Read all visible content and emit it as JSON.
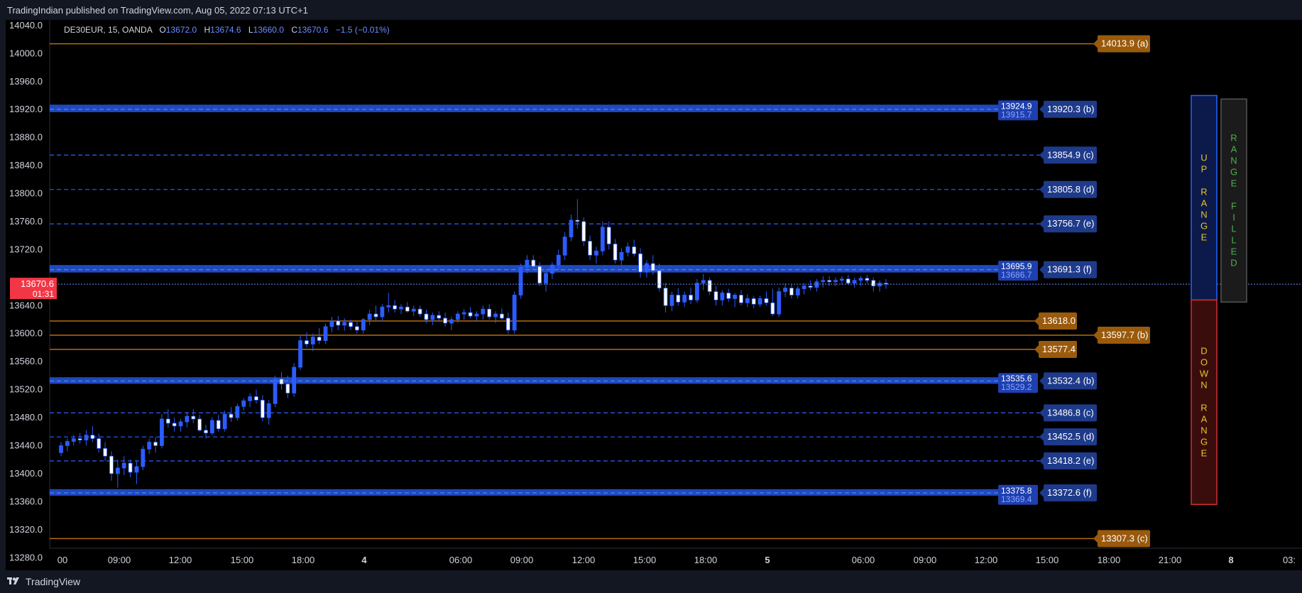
{
  "header": {
    "published": "TradingIndian published on TradingView.com, Aug 05, 2022 07:13 UTC+1"
  },
  "legend": {
    "symbol": "DE30EUR, 15, OANDA",
    "o_label": "O",
    "o": "13672.0",
    "h_label": "H",
    "h": "13674.6",
    "l_label": "L",
    "l": "13660.0",
    "c_label": "C",
    "c": "13670.6",
    "change": "−1.5 (−0.01%)"
  },
  "footer": {
    "brand": "TradingView"
  },
  "colors": {
    "background": "#000000",
    "blue": "#2962ff",
    "blue_label": "#1e3a8a",
    "orange": "#b86a10",
    "orange_label": "#9a5a0c",
    "candle_up": "#2b5cff",
    "candle_down": "#ffffff",
    "current_price": "#f23645"
  },
  "current_price": {
    "value": "13670.6",
    "countdown": "01:31",
    "level": 13670.6
  },
  "chart_data": {
    "type": "candlestick",
    "y_axis": {
      "ylim": [
        13262,
        14048
      ],
      "ticks": [
        14040.0,
        14000.0,
        13960.0,
        13920.0,
        13880.0,
        13840.0,
        13800.0,
        13760.0,
        13720.0,
        13640.0,
        13600.0,
        13560.0,
        13520.0,
        13480.0,
        13440.0,
        13400.0,
        13360.0,
        13320.0,
        13280.0
      ],
      "tick_labels": [
        "14040.0",
        "14000.0",
        "13960.0",
        "13920.0",
        "13880.0",
        "13840.0",
        "13800.0",
        "13760.0",
        "13720.0",
        "13640.0",
        "13600.0",
        "13560.0",
        "13520.0",
        "13480.0",
        "13440.0",
        "13400.0",
        "13360.0",
        "13320.0",
        "13280.0"
      ]
    },
    "x_axis": {
      "tick_labels": [
        "00",
        "09:00",
        "12:00",
        "15:00",
        "18:00",
        "4",
        "06:00",
        "09:00",
        "12:00",
        "15:00",
        "18:00",
        "5",
        "06:00",
        "09:00",
        "12:00",
        "15:00",
        "18:00",
        "21:00",
        "8",
        "03:"
      ],
      "bold": [
        "4",
        "5",
        "8"
      ]
    },
    "levels": [
      {
        "label": "14013.9 (a)",
        "value": 14013.9,
        "color": "orange",
        "style": "solid",
        "tag": "wide"
      },
      {
        "label": "13920.3 (b)",
        "value": 13920.3,
        "color": "blue",
        "style": "band",
        "upper": 13924.9,
        "upper_label": "13924.9",
        "lower_label": "13915.7"
      },
      {
        "label": "13854.9 (c)",
        "value": 13854.9,
        "color": "blue",
        "style": "dashed"
      },
      {
        "label": "13805.8 (d)",
        "value": 13805.8,
        "color": "blue",
        "style": "dashed"
      },
      {
        "label": "13756.7 (e)",
        "value": 13756.7,
        "color": "blue",
        "style": "dashed"
      },
      {
        "label": "13691.3 (f)",
        "value": 13691.3,
        "color": "blue",
        "style": "band",
        "upper": 13695.9,
        "upper_label": "13695.9",
        "lower_label": "13686.7"
      },
      {
        "label": "13618.0",
        "value": 13618.0,
        "color": "orange",
        "style": "solid",
        "tag": "short"
      },
      {
        "label": "13597.7 (b)",
        "value": 13597.7,
        "color": "orange",
        "style": "solid",
        "tag": "wide"
      },
      {
        "label": "13577.4",
        "value": 13577.4,
        "color": "orange",
        "style": "solid",
        "tag": "short"
      },
      {
        "label": "13532.4 (b)",
        "value": 13532.4,
        "color": "blue",
        "style": "band",
        "upper": 13535.6,
        "upper_label": "13535.6",
        "lower_label": "13529.2"
      },
      {
        "label": "13486.8 (c)",
        "value": 13486.8,
        "color": "blue",
        "style": "dashed"
      },
      {
        "label": "13452.5 (d)",
        "value": 13452.5,
        "color": "blue",
        "style": "dashed"
      },
      {
        "label": "13418.2 (e)",
        "value": 13418.2,
        "color": "blue",
        "style": "dashed"
      },
      {
        "label": "13372.6 (f)",
        "value": 13372.6,
        "color": "blue",
        "style": "band",
        "upper": 13375.8,
        "upper_label": "13375.8",
        "lower_label": "13369.4"
      },
      {
        "label": "13307.3 (c)",
        "value": 13307.3,
        "color": "orange",
        "style": "solid",
        "tag": "wide"
      }
    ],
    "range_boxes": [
      {
        "text": "UP RANGE",
        "top": 13940,
        "bottom": 13648,
        "text_color": "#e6c229",
        "border": "#2962ff",
        "fill": "#0b1a4a"
      },
      {
        "text": "DOWN RANGE",
        "top": 13648,
        "bottom": 13356,
        "text_color": "#e6c229",
        "border": "#d32f2f",
        "fill": "#3a0d0d"
      },
      {
        "text": "RANGE FILLED",
        "top": 13935,
        "bottom": 13645,
        "text_color": "#4caf50",
        "border": "#555555",
        "fill": "#1b1b1b"
      }
    ],
    "candles": [
      [
        13430,
        13445,
        13425,
        13440
      ],
      [
        13440,
        13450,
        13432,
        13446
      ],
      [
        13446,
        13455,
        13440,
        13450
      ],
      [
        13450,
        13458,
        13443,
        13448
      ],
      [
        13448,
        13462,
        13440,
        13455
      ],
      [
        13455,
        13468,
        13445,
        13450
      ],
      [
        13450,
        13457,
        13430,
        13436
      ],
      [
        13436,
        13445,
        13418,
        13425
      ],
      [
        13425,
        13432,
        13390,
        13400
      ],
      [
        13400,
        13420,
        13380,
        13408
      ],
      [
        13408,
        13425,
        13398,
        13415
      ],
      [
        13415,
        13420,
        13395,
        13402
      ],
      [
        13402,
        13418,
        13385,
        13410
      ],
      [
        13410,
        13440,
        13405,
        13435
      ],
      [
        13435,
        13450,
        13428,
        13445
      ],
      [
        13445,
        13452,
        13430,
        13440
      ],
      [
        13440,
        13485,
        13436,
        13478
      ],
      [
        13478,
        13492,
        13466,
        13472
      ],
      [
        13472,
        13480,
        13460,
        13468
      ],
      [
        13468,
        13478,
        13460,
        13474
      ],
      [
        13474,
        13488,
        13466,
        13482
      ],
      [
        13482,
        13492,
        13472,
        13478
      ],
      [
        13478,
        13484,
        13460,
        13462
      ],
      [
        13462,
        13470,
        13450,
        13458
      ],
      [
        13458,
        13480,
        13455,
        13476
      ],
      [
        13476,
        13484,
        13460,
        13464
      ],
      [
        13464,
        13490,
        13460,
        13485
      ],
      [
        13485,
        13495,
        13474,
        13480
      ],
      [
        13480,
        13500,
        13476,
        13496
      ],
      [
        13496,
        13508,
        13490,
        13504
      ],
      [
        13504,
        13515,
        13495,
        13510
      ],
      [
        13510,
        13520,
        13500,
        13505
      ],
      [
        13505,
        13512,
        13475,
        13480
      ],
      [
        13480,
        13505,
        13470,
        13500
      ],
      [
        13500,
        13540,
        13495,
        13535
      ],
      [
        13535,
        13545,
        13520,
        13528
      ],
      [
        13528,
        13540,
        13508,
        13515
      ],
      [
        13515,
        13558,
        13510,
        13552
      ],
      [
        13552,
        13598,
        13548,
        13590
      ],
      [
        13590,
        13602,
        13580,
        13585
      ],
      [
        13585,
        13600,
        13575,
        13595
      ],
      [
        13595,
        13608,
        13585,
        13590
      ],
      [
        13590,
        13614,
        13585,
        13610
      ],
      [
        13610,
        13624,
        13602,
        13618
      ],
      [
        13618,
        13625,
        13605,
        13612
      ],
      [
        13612,
        13622,
        13604,
        13616
      ],
      [
        13616,
        13620,
        13605,
        13610
      ],
      [
        13610,
        13618,
        13600,
        13605
      ],
      [
        13605,
        13622,
        13600,
        13620
      ],
      [
        13620,
        13634,
        13612,
        13628
      ],
      [
        13628,
        13640,
        13618,
        13624
      ],
      [
        13624,
        13642,
        13618,
        13638
      ],
      [
        13638,
        13658,
        13630,
        13640
      ],
      [
        13640,
        13648,
        13630,
        13635
      ],
      [
        13635,
        13642,
        13628,
        13638
      ],
      [
        13638,
        13645,
        13630,
        13632
      ],
      [
        13632,
        13640,
        13625,
        13635
      ],
      [
        13635,
        13640,
        13624,
        13628
      ],
      [
        13628,
        13634,
        13615,
        13620
      ],
      [
        13620,
        13630,
        13612,
        13626
      ],
      [
        13626,
        13632,
        13618,
        13622
      ],
      [
        13622,
        13630,
        13610,
        13615
      ],
      [
        13615,
        13624,
        13605,
        13620
      ],
      [
        13620,
        13632,
        13615,
        13628
      ],
      [
        13628,
        13635,
        13620,
        13630
      ],
      [
        13630,
        13638,
        13622,
        13625
      ],
      [
        13625,
        13632,
        13618,
        13628
      ],
      [
        13628,
        13640,
        13620,
        13635
      ],
      [
        13635,
        13642,
        13620,
        13624
      ],
      [
        13624,
        13632,
        13615,
        13628
      ],
      [
        13628,
        13636,
        13620,
        13622
      ],
      [
        13622,
        13630,
        13600,
        13605
      ],
      [
        13605,
        13660,
        13600,
        13655
      ],
      [
        13655,
        13700,
        13650,
        13695
      ],
      [
        13695,
        13712,
        13686,
        13705
      ],
      [
        13705,
        13712,
        13690,
        13696
      ],
      [
        13696,
        13702,
        13668,
        13672
      ],
      [
        13672,
        13690,
        13660,
        13686
      ],
      [
        13686,
        13702,
        13678,
        13698
      ],
      [
        13698,
        13720,
        13690,
        13712
      ],
      [
        13712,
        13745,
        13705,
        13738
      ],
      [
        13738,
        13770,
        13732,
        13762
      ],
      [
        13762,
        13792,
        13750,
        13760
      ],
      [
        13760,
        13766,
        13725,
        13732
      ],
      [
        13732,
        13740,
        13705,
        13712
      ],
      [
        13712,
        13724,
        13700,
        13718
      ],
      [
        13718,
        13760,
        13712,
        13752
      ],
      [
        13752,
        13760,
        13720,
        13728
      ],
      [
        13728,
        13735,
        13700,
        13705
      ],
      [
        13705,
        13722,
        13698,
        13716
      ],
      [
        13716,
        13730,
        13710,
        13724
      ],
      [
        13724,
        13734,
        13710,
        13714
      ],
      [
        13714,
        13722,
        13680,
        13688
      ],
      [
        13688,
        13705,
        13680,
        13700
      ],
      [
        13700,
        13712,
        13684,
        13690
      ],
      [
        13690,
        13700,
        13660,
        13665
      ],
      [
        13665,
        13672,
        13630,
        13640
      ],
      [
        13640,
        13660,
        13632,
        13655
      ],
      [
        13655,
        13665,
        13640,
        13645
      ],
      [
        13645,
        13660,
        13638,
        13655
      ],
      [
        13655,
        13666,
        13642,
        13648
      ],
      [
        13648,
        13678,
        13644,
        13672
      ],
      [
        13672,
        13685,
        13662,
        13676
      ],
      [
        13676,
        13680,
        13655,
        13660
      ],
      [
        13660,
        13668,
        13640,
        13648
      ],
      [
        13648,
        13662,
        13640,
        13658
      ],
      [
        13658,
        13664,
        13645,
        13650
      ],
      [
        13650,
        13658,
        13638,
        13655
      ],
      [
        13655,
        13662,
        13640,
        13644
      ],
      [
        13644,
        13656,
        13638,
        13650
      ],
      [
        13650,
        13654,
        13636,
        13642
      ],
      [
        13642,
        13654,
        13638,
        13650
      ],
      [
        13650,
        13660,
        13640,
        13644
      ],
      [
        13644,
        13664,
        13625,
        13628
      ],
      [
        13628,
        13666,
        13624,
        13660
      ],
      [
        13660,
        13672,
        13652,
        13665
      ],
      [
        13665,
        13670,
        13650,
        13655
      ],
      [
        13655,
        13668,
        13650,
        13664
      ],
      [
        13664,
        13672,
        13656,
        13668
      ],
      [
        13668,
        13676,
        13662,
        13666
      ],
      [
        13666,
        13678,
        13660,
        13674
      ],
      [
        13674,
        13682,
        13666,
        13676
      ],
      [
        13676,
        13682,
        13668,
        13674
      ],
      [
        13674,
        13680,
        13668,
        13676
      ],
      [
        13676,
        13682,
        13670,
        13678
      ],
      [
        13678,
        13684,
        13670,
        13672
      ],
      [
        13672,
        13680,
        13666,
        13676
      ],
      [
        13676,
        13682,
        13668,
        13679
      ],
      [
        13679,
        13684,
        13672,
        13676
      ],
      [
        13676,
        13680,
        13660,
        13668
      ],
      [
        13668,
        13676,
        13660,
        13672
      ],
      [
        13672,
        13678,
        13664,
        13670.6
      ]
    ]
  }
}
